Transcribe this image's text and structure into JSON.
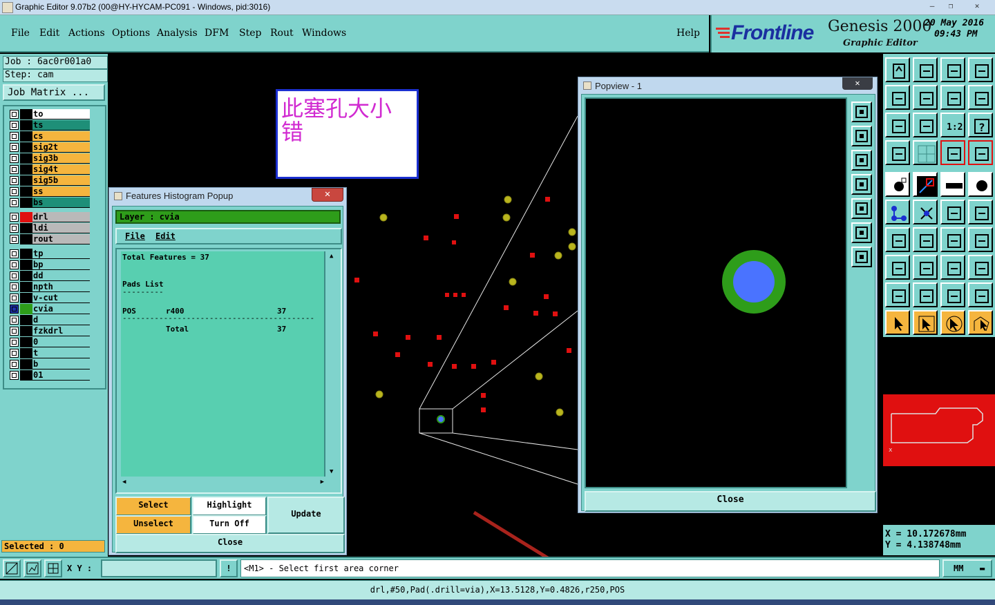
{
  "window": {
    "title": "Graphic Editor 9.07b2 (00@HY-HYCAM-PC091 - Windows, pid:3016)"
  },
  "menu": {
    "items": [
      "File",
      "Edit",
      "Actions",
      "Options",
      "Analysis",
      "DFM",
      "Step",
      "Rout",
      "Windows"
    ],
    "help": "Help"
  },
  "brand": {
    "logo": "Frontline",
    "product": "Genesis 2000",
    "subtitle": "Graphic Editor",
    "date": "20 May 2016",
    "time": "09:43 PM"
  },
  "job": {
    "job_line": "Job : 6ac0r001a0",
    "step_line": "Step: cam",
    "matrix_button": "Job Matrix ..."
  },
  "layers": [
    {
      "name": "to",
      "bg": "#ffffff",
      "swatch": "#000000",
      "checked": false
    },
    {
      "name": "ts",
      "bg": "#1e8f78",
      "swatch": "#000000",
      "checked": false
    },
    {
      "name": "cs",
      "bg": "#f5b53e",
      "swatch": "#000000",
      "checked": false
    },
    {
      "name": "sig2t",
      "bg": "#f5b53e",
      "swatch": "#000000",
      "checked": false
    },
    {
      "name": "sig3b",
      "bg": "#f5b53e",
      "swatch": "#000000",
      "checked": false
    },
    {
      "name": "sig4t",
      "bg": "#f5b53e",
      "swatch": "#000000",
      "checked": false
    },
    {
      "name": "sig5b",
      "bg": "#f5b53e",
      "swatch": "#000000",
      "checked": false
    },
    {
      "name": "ss",
      "bg": "#f5b53e",
      "swatch": "#000000",
      "checked": false
    },
    {
      "name": "bs",
      "bg": "#1e8f78",
      "swatch": "#000000",
      "checked": false
    },
    {
      "name": "drl",
      "bg": "#b9b9b9",
      "swatch": "#e01010",
      "checked": false
    },
    {
      "name": "ldi",
      "bg": "#b9b9b9",
      "swatch": "#000000",
      "checked": false
    },
    {
      "name": "rout",
      "bg": "#b9b9b9",
      "swatch": "#000000",
      "checked": false
    },
    {
      "name": "tp",
      "bg": "#7fd3cc",
      "swatch": "#000000",
      "checked": false
    },
    {
      "name": "bp",
      "bg": "#7fd3cc",
      "swatch": "#000000",
      "checked": false
    },
    {
      "name": "dd",
      "bg": "#7fd3cc",
      "swatch": "#000000",
      "checked": false
    },
    {
      "name": "npth",
      "bg": "#7fd3cc",
      "swatch": "#000000",
      "checked": false
    },
    {
      "name": "v-cut",
      "bg": "#7fd3cc",
      "swatch": "#000000",
      "checked": false
    },
    {
      "name": "cvia",
      "bg": "#7fd3cc",
      "swatch": "#2e9d1a",
      "checked": true
    },
    {
      "name": "d",
      "bg": "#7fd3cc",
      "swatch": "#000000",
      "checked": false
    },
    {
      "name": "fzkdrl",
      "bg": "#7fd3cc",
      "swatch": "#000000",
      "checked": false
    },
    {
      "name": "0",
      "bg": "#7fd3cc",
      "swatch": "#000000",
      "checked": false
    },
    {
      "name": "t",
      "bg": "#7fd3cc",
      "swatch": "#000000",
      "checked": false
    },
    {
      "name": "b",
      "bg": "#7fd3cc",
      "swatch": "#000000",
      "checked": false
    },
    {
      "name": "01",
      "bg": "#7fd3cc",
      "swatch": "#000000",
      "checked": false
    }
  ],
  "selected": "Selected : 0",
  "annotation_note": {
    "line1": "此塞孔大小",
    "line2": "错"
  },
  "histogram": {
    "title": "Features Histogram Popup",
    "layer": "Layer :  cvia",
    "menu_file": "File",
    "menu_edit": "Edit",
    "total": "Total Features = 37",
    "pads_list": "Pads List",
    "dashes_short": "---------",
    "row_type": "POS",
    "row_sym": "r400",
    "row_count": "37",
    "dashes_long": "------------------------------------------",
    "total_label": "Total",
    "total_count": "37",
    "btn_select": "Select",
    "btn_highlight": "Highlight",
    "btn_update": "Update",
    "btn_unselect": "Unselect",
    "btn_turnoff": "Turn Off",
    "btn_close": "Close"
  },
  "popview": {
    "title": "Popview - 1",
    "close": "Close"
  },
  "coords": {
    "x": "X = 10.172678mm",
    "y": "Y = 4.138748mm"
  },
  "status": {
    "xy_label": "X Y :",
    "xy_value": "",
    "prompt": "<M1> - Select first area corner",
    "units": "MM",
    "info": "drl,#50,Pad(.drill=via),X=13.5128,Y=0.4826,r250,POS"
  },
  "colors": {
    "panel": "#7fd3cc",
    "accent_orange": "#f5b53e",
    "layer_green": "#2e9d1a",
    "pad_red": "#e01010",
    "pad_yellow": "#b9b51e",
    "note_text": "#d12ad1",
    "pad_blue": "#4a73ff"
  }
}
